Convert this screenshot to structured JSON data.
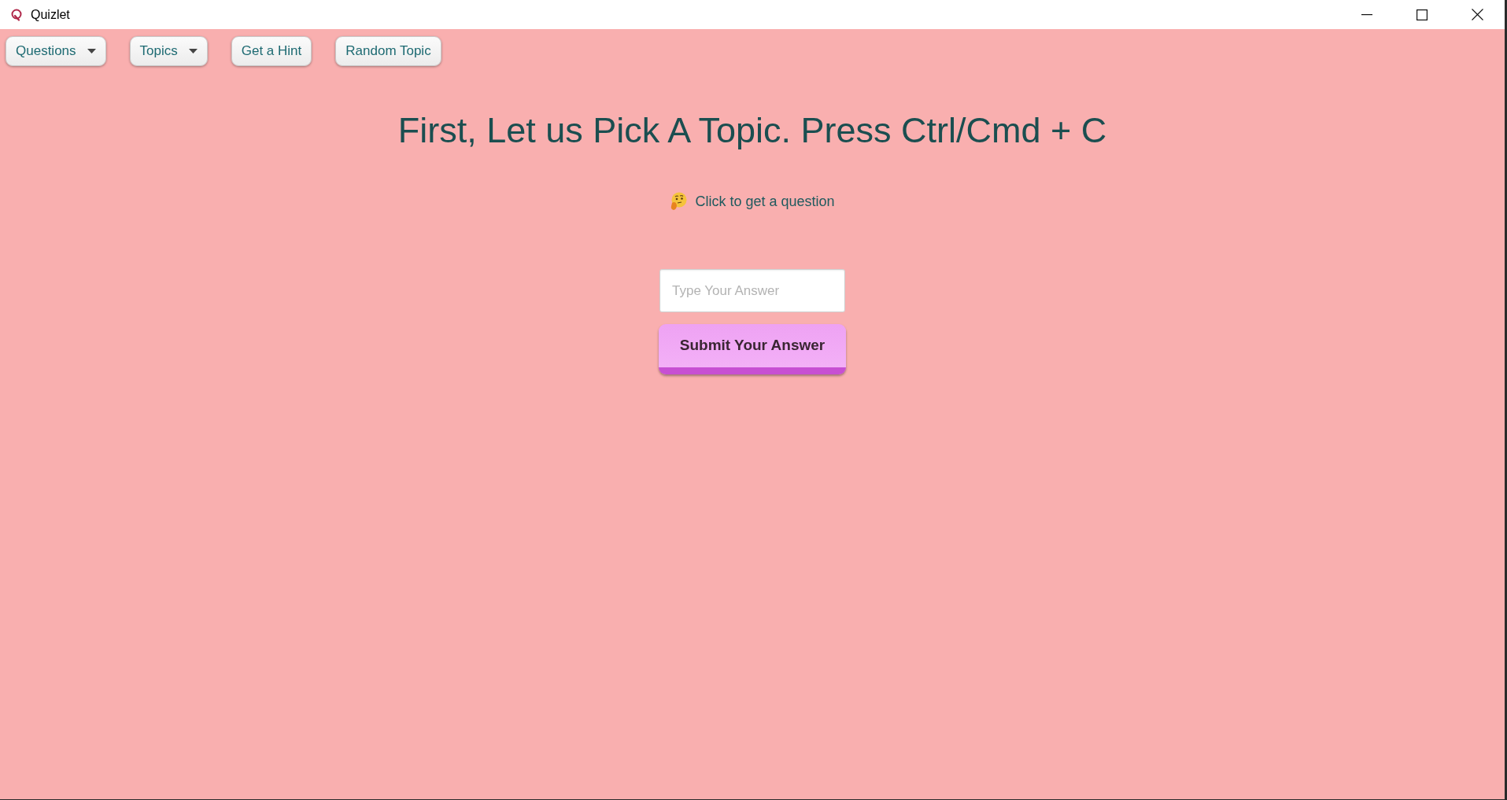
{
  "window": {
    "title": "Quizlet"
  },
  "toolbar": [
    {
      "label": "Questions",
      "kind": "dropdown"
    },
    {
      "label": "Topics",
      "kind": "dropdown"
    },
    {
      "label": "Get a Hint",
      "kind": "button"
    },
    {
      "label": "Random Topic",
      "kind": "button"
    }
  ],
  "heading": "First, Let us Pick A Topic. Press Ctrl/Cmd + C",
  "prompt": {
    "text": "Click to get a question"
  },
  "answer_field": {
    "placeholder": "Type Your Answer"
  },
  "submit_button": {
    "label": "Submit Your Answer"
  }
}
